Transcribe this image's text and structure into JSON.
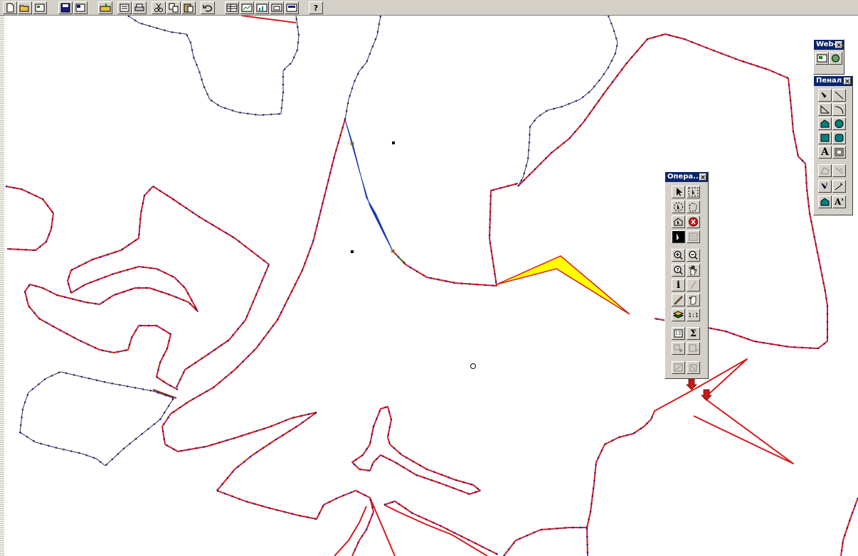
{
  "toolbar": {
    "buttons": [
      {
        "name": "new-icon"
      },
      {
        "name": "open-icon"
      },
      {
        "name": "open-workspace-icon"
      },
      {
        "name": "save-icon"
      },
      {
        "name": "save-workspace-icon"
      },
      {
        "name": "import-icon"
      },
      {
        "name": "print-preview-icon"
      },
      {
        "name": "print-icon"
      },
      {
        "name": "cut-icon"
      },
      {
        "name": "copy-icon"
      },
      {
        "name": "paste-icon"
      },
      {
        "name": "undo-icon"
      },
      {
        "name": "new-browser-icon"
      },
      {
        "name": "new-map-icon"
      },
      {
        "name": "new-graph-icon"
      },
      {
        "name": "new-layout-icon"
      },
      {
        "name": "redistrict-icon"
      },
      {
        "name": "help-icon",
        "label": "?"
      }
    ]
  },
  "palettes": {
    "web": {
      "title": "Web-c...",
      "close": "×"
    },
    "penal": {
      "title": "Пенал",
      "close": "×",
      "buttons": [
        {
          "name": "symbol-tool-icon"
        },
        {
          "name": "line-tool-icon"
        },
        {
          "name": "polyline-tool-icon"
        },
        {
          "name": "arc-tool-icon"
        },
        {
          "name": "polygon-tool-icon"
        },
        {
          "name": "ellipse-tool-icon"
        },
        {
          "name": "rectangle-tool-icon"
        },
        {
          "name": "rounded-rectangle-tool-icon"
        },
        {
          "name": "text-tool-icon",
          "label": "A"
        },
        {
          "name": "frame-tool-icon"
        },
        {
          "name": "reshape-tool-icon"
        },
        {
          "name": "add-node-tool-icon"
        },
        {
          "name": "symbol-style-icon"
        },
        {
          "name": "line-style-icon"
        },
        {
          "name": "region-style-icon"
        },
        {
          "name": "text-style-icon",
          "label": "A'"
        }
      ]
    },
    "operations": {
      "title": "Опера...",
      "close": "×",
      "buttons": [
        {
          "name": "select-arrow-icon"
        },
        {
          "name": "marquee-select-icon"
        },
        {
          "name": "radius-select-icon"
        },
        {
          "name": "polygon-select-icon"
        },
        {
          "name": "boundary-select-icon"
        },
        {
          "name": "unselect-icon"
        },
        {
          "name": "graph-select-icon"
        },
        {
          "name": "invert-select-icon"
        },
        {
          "name": "zoom-in-icon"
        },
        {
          "name": "zoom-out-icon"
        },
        {
          "name": "change-view-icon"
        },
        {
          "name": "grabber-hand-icon"
        },
        {
          "name": "info-tool-icon",
          "label": "i"
        },
        {
          "name": "hotlink-icon"
        },
        {
          "name": "ruler-icon"
        },
        {
          "name": "drag-window-icon"
        },
        {
          "name": "layer-control-icon"
        },
        {
          "name": "show-scale-icon",
          "label": "1:1"
        },
        {
          "name": "legend-icon"
        },
        {
          "name": "statistics-icon",
          "label": "Σ"
        },
        {
          "name": "label-tool-icon"
        },
        {
          "name": "drag-map-icon"
        },
        {
          "name": "clip-region-icon"
        },
        {
          "name": "set-target-icon"
        }
      ]
    }
  },
  "colors": {
    "boundary_selected": "#d41c1c",
    "boundary_plain": "#303030",
    "node": "#1a1aa8",
    "highlight_yellow": "#ffff00",
    "highlight_blue": "#1a3ab0",
    "palette_title_bg": "#0a246a",
    "chrome": "#d4d0c8"
  }
}
